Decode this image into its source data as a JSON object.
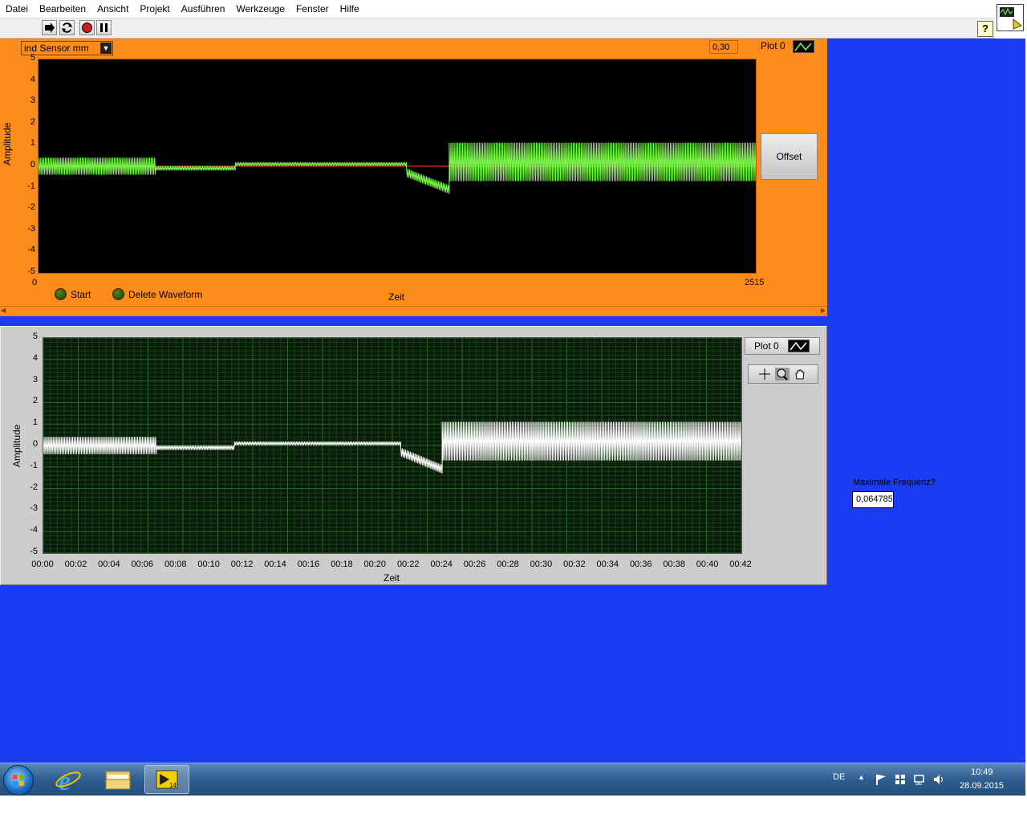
{
  "menu": [
    "Datei",
    "Bearbeiten",
    "Ansicht",
    "Projekt",
    "Ausführen",
    "Werkzeuge",
    "Fenster",
    "Hilfe"
  ],
  "colors": {
    "workspace": "#1a3cf4",
    "orange_panel": "#fd8c1a",
    "green_trace": "#7cf84a",
    "white_trace": "#ffffff",
    "zero_line": "#ff4040"
  },
  "top_panel": {
    "channel_select": "ind Sensor mm",
    "numeric_value": "0,30",
    "plot_legend": "Plot 0",
    "y_title": "Amplitude",
    "x_title": "Zeit",
    "y_ticks": [
      "5",
      "4",
      "3",
      "2",
      "1",
      "0",
      "-1",
      "-2",
      "-3",
      "-4",
      "-5"
    ],
    "x_min": "0",
    "x_max": "2515",
    "start_label": "Start",
    "delete_label": "Delete Waveform",
    "offset_button": "Offset"
  },
  "bottom_panel": {
    "plot_legend": "Plot 0",
    "y_title": "Amplitude",
    "x_title": "Zeit",
    "y_ticks": [
      "5",
      "4",
      "3",
      "2",
      "1",
      "0",
      "-1",
      "-2",
      "-3",
      "-4",
      "-5"
    ],
    "x_ticks": [
      "00:00",
      "00:02",
      "00:04",
      "00:06",
      "00:08",
      "00:10",
      "00:12",
      "00:14",
      "00:16",
      "00:18",
      "00:20",
      "00:22",
      "00:24",
      "00:26",
      "00:28",
      "00:30",
      "00:32",
      "00:34",
      "00:36",
      "00:38",
      "00:40",
      "00:42"
    ]
  },
  "frequency": {
    "label": "Maximale Frequenz?",
    "value": "0,064785"
  },
  "taskbar": {
    "language": "DE",
    "time": "10:49",
    "date": "28.09.2015"
  },
  "chart_data": [
    {
      "type": "line",
      "ylabel": "Amplitude",
      "xlabel": "Zeit",
      "ylim": [
        -5,
        5
      ],
      "xlim": [
        0,
        2515
      ],
      "series": [
        {
          "values_description_segments": [
            {
              "x": [
                0,
                410
              ],
              "center": 0,
              "amplitude": 0.4
            },
            {
              "x": [
                410,
                690
              ],
              "center": -0.1,
              "amplitude": 0.1
            },
            {
              "x": [
                690,
                1290
              ],
              "center": 0.1,
              "amplitude": 0.08
            },
            {
              "x": [
                1290,
                1440
              ],
              "center": -0.9,
              "amplitude": 0.2
            },
            {
              "x": [
                1440,
                2515
              ],
              "center": 0.2,
              "amplitude": 0.9
            }
          ]
        }
      ]
    },
    {
      "type": "line",
      "ylabel": "Amplitude",
      "xlabel": "Zeit",
      "ylim": [
        -5,
        5
      ],
      "x": [
        "00:00",
        "00:42"
      ],
      "series": [
        {
          "values_description_segments": [
            {
              "x": [
                0,
                6.8
              ],
              "center": 0,
              "amplitude": 0.4
            },
            {
              "x": [
                6.8,
                11.5
              ],
              "center": -0.1,
              "amplitude": 0.1
            },
            {
              "x": [
                11.5,
                21.5
              ],
              "center": 0.1,
              "amplitude": 0.08
            },
            {
              "x": [
                21.5,
                24
              ],
              "center": -0.9,
              "amplitude": 0.2
            },
            {
              "x": [
                24,
                42
              ],
              "center": 0.2,
              "amplitude": 0.9
            }
          ]
        }
      ]
    }
  ]
}
